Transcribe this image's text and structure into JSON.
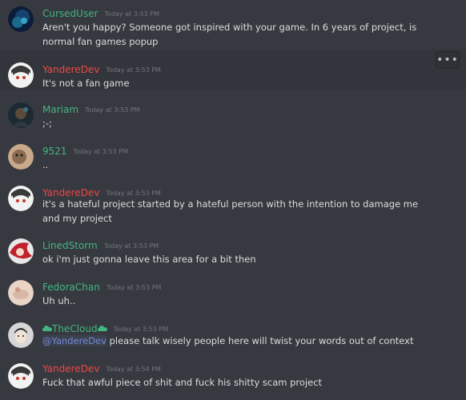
{
  "messages": [
    {
      "author": "CursedUser",
      "color": "#43b581",
      "time": "Today at 3:53 PM",
      "text": "Aren't you happy? Someone got inspired  with your game. In 6 years of project, is normal fan games popup",
      "avatar": "space"
    },
    {
      "author": "YandereDev",
      "color": "#f04747",
      "time": "Today at 3:53 PM",
      "text": "It's not a fan game",
      "avatar": "anime"
    },
    {
      "author": "Mariam",
      "color": "#43b581",
      "time": "Today at 3:53 PM",
      "text": ";-;",
      "avatar": "dark"
    },
    {
      "author": "9521",
      "color": "#43b581",
      "time": "Today at 3:53 PM",
      "text": "..",
      "avatar": "pup"
    },
    {
      "author": "YandereDev",
      "color": "#f04747",
      "time": "Today at 3:53 PM",
      "text": "it's a hateful project started by a hateful person with the intention to damage me and my project",
      "avatar": "anime"
    },
    {
      "author": "LinedStorm",
      "color": "#43b581",
      "time": "Today at 3:53 PM",
      "text": "ok i'm just gonna leave this area for a bit then",
      "avatar": "red"
    },
    {
      "author": "FedoraChan",
      "color": "#43b581",
      "time": "Today at 3:53 PM",
      "text": "Uh uh..",
      "avatar": "pale"
    },
    {
      "author": "TheCloud",
      "color": "#43b581",
      "time": "Today at 3:53 PM",
      "mention": "@YandereDev",
      "text": " please talk wisely people here will twist your words out of context",
      "avatar": "boy"
    },
    {
      "author": "YandereDev",
      "color": "#f04747",
      "time": "Today at 3:54 PM",
      "text": "Fuck that awful piece of shit and fuck his shitty scam project",
      "avatar": "anime"
    }
  ],
  "more_button_label": "•••"
}
